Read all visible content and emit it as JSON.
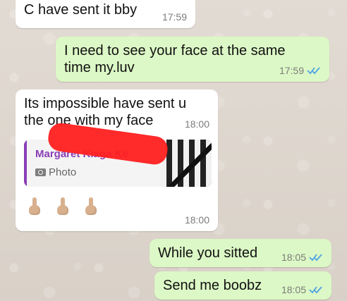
{
  "messages": [
    {
      "id": "m1",
      "direction": "incoming",
      "text": "C have sent it bby",
      "time": "17:59"
    },
    {
      "id": "m2",
      "direction": "outgoing",
      "text": "I need to see your face at the  same time my.luv",
      "time": "17:59",
      "status_icon": "double-check-icon"
    },
    {
      "id": "m3",
      "direction": "incoming",
      "text": "Its impossible have sent u the one with my face",
      "time": "18:00"
    },
    {
      "id": "m4",
      "direction": "incoming",
      "quoted_author": "Margaret Kiaga Ke",
      "quoted_type": "Photo",
      "emoji_text": "☝☝☝",
      "time": "18:00"
    },
    {
      "id": "m5",
      "direction": "outgoing",
      "text": "While  you sitted",
      "time": "18:05",
      "status_icon": "double-check-icon"
    },
    {
      "id": "m6",
      "direction": "outgoing",
      "text": "Send me boobz",
      "time": "18:05",
      "status_icon": "double-check-icon"
    }
  ],
  "colors": {
    "incoming": "#ffffff",
    "outgoing": "#dcf8c6",
    "tick": "#4fa3e3",
    "quote_accent": "#8b3fb6",
    "redaction": "#ff1f1f"
  }
}
